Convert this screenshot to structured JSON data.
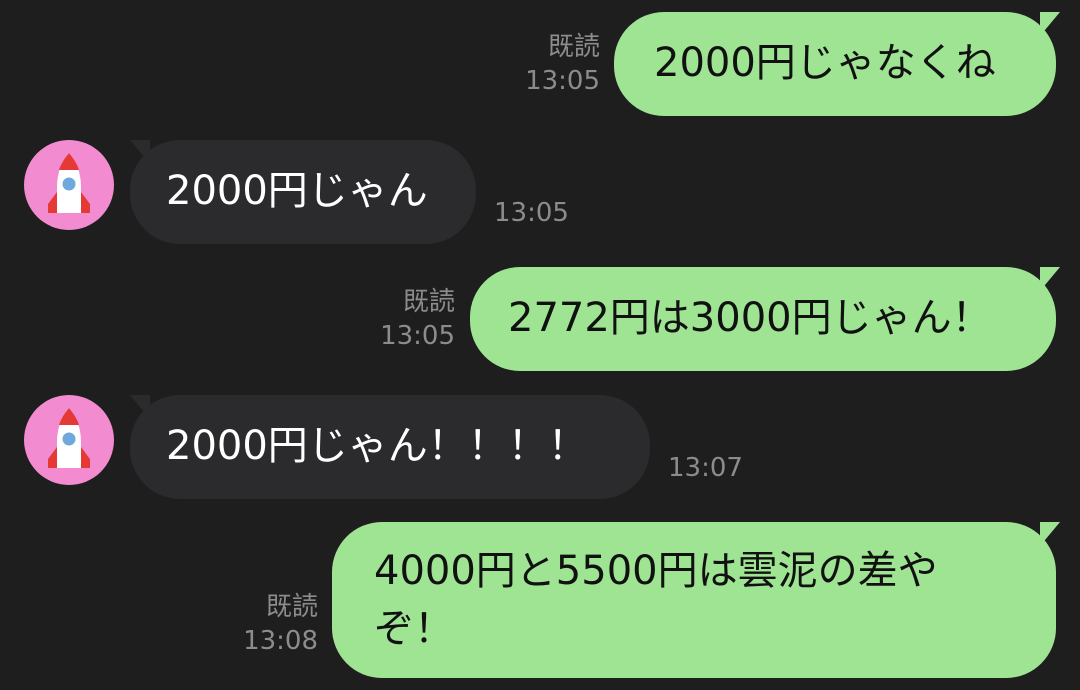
{
  "messages": [
    {
      "direction": "out",
      "text": "2000円じゃなくね",
      "read": "既読",
      "time": "13:05"
    },
    {
      "direction": "in",
      "text": "2000円じゃん",
      "time": "13:05",
      "avatar_icon": "rocket-icon"
    },
    {
      "direction": "out",
      "text": "2772円は3000円じゃん！",
      "read": "既読",
      "time": "13:05"
    },
    {
      "direction": "in",
      "text": "2000円じゃん！！！！",
      "time": "13:07",
      "avatar_icon": "rocket-icon"
    },
    {
      "direction": "out",
      "text_lines": [
        "4000円と5500円は雲泥の差や",
        "ぞ！"
      ],
      "read": "既読",
      "time": "13:08"
    }
  ],
  "colors": {
    "background": "#1e1e1f",
    "outgoing_bubble": "#9ee493",
    "incoming_bubble": "#2b2b2d",
    "avatar_bg": "#f28bcf",
    "meta_text": "#8c8c8c"
  }
}
